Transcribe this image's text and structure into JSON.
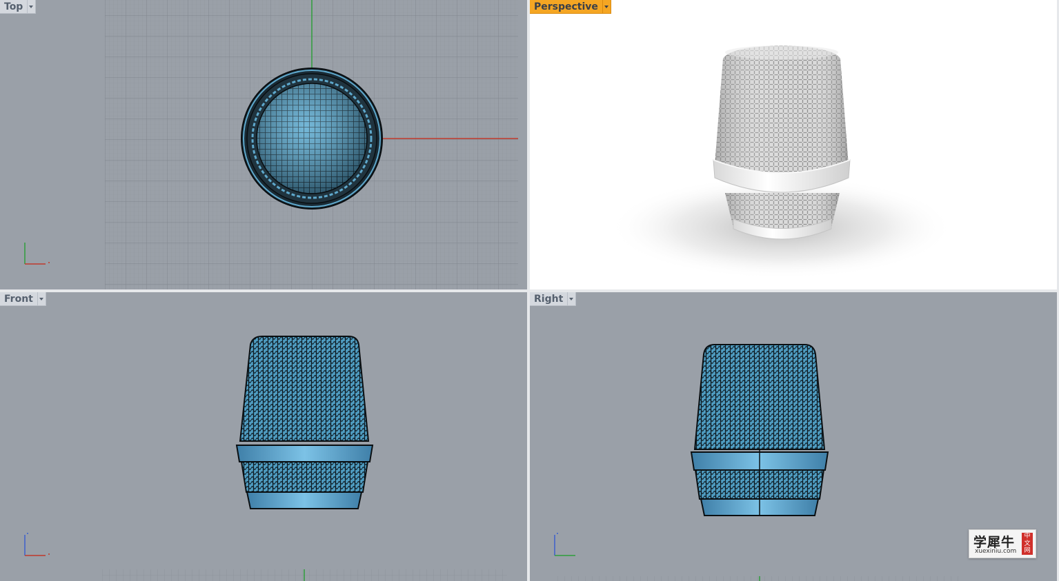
{
  "viewports": {
    "top": {
      "label": "Top"
    },
    "perspective": {
      "label": "Perspective"
    },
    "front": {
      "label": "Front"
    },
    "right": {
      "label": "Right"
    }
  },
  "active_viewport": "perspective",
  "colors": {
    "viewport_bg": "#9aa0a8",
    "grid_minor": "#8f959d",
    "grid_major": "#7e848c",
    "x_axis": "#c0392b",
    "y_axis": "#2e9e3a",
    "active_tab": "#f5a623",
    "mesh_blue": "#5ea8cc",
    "mesh_dark": "#0f1c24"
  },
  "watermark": {
    "name": "学犀牛",
    "url": "xuexiniu.com",
    "badge": "中文网"
  }
}
